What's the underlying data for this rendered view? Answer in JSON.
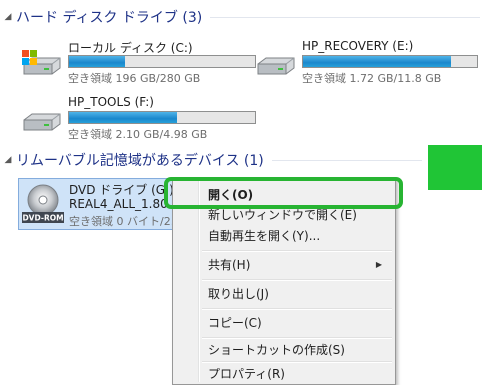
{
  "groups": {
    "hard_disks": {
      "arrow": "◢",
      "title": "ハード ディスク ドライブ (3)"
    },
    "removable": {
      "arrow": "◢",
      "title": "リムーバブル記憶域があるデバイス (1)"
    }
  },
  "drives": [
    {
      "name": "ローカル ディスク (C:)",
      "free": "空き領域 196 GB/280 GB",
      "used_fraction": 0.3,
      "icon": "windows-hard-drive-icon"
    },
    {
      "name": "HP_RECOVERY (E:)",
      "free": "空き領域 1.72 GB/11.8 GB",
      "used_fraction": 0.85,
      "icon": "hard-drive-icon"
    },
    {
      "name": "HP_TOOLS (F:)",
      "free": "空き領域 2.10 GB/4.98 GB",
      "used_fraction": 0.58,
      "icon": "hard-drive-icon"
    }
  ],
  "dvd": {
    "name": "DVD ドライブ (G:)",
    "label": "REAL4_ALL_1.80",
    "free": "空き領域 0 バイト/2.",
    "icon": "dvd-rom-icon",
    "icon_text": "DVD-ROM"
  },
  "context_menu": {
    "open": "開く(O)",
    "open_new_window": "新しいウィンドウで開く(E)",
    "autoplay": "自動再生を開く(Y)...",
    "share": "共有(H)",
    "share_arrow": "▶",
    "eject": "取り出し(J)",
    "copy": "コピー(C)",
    "create_shortcut": "ショートカットの作成(S)",
    "properties": "プロパティ(R)"
  },
  "colors": {
    "highlight_border": "#27b432",
    "green_block": "#20c536",
    "bar_fill": "#26a0da",
    "group_title": "#1e3287"
  }
}
